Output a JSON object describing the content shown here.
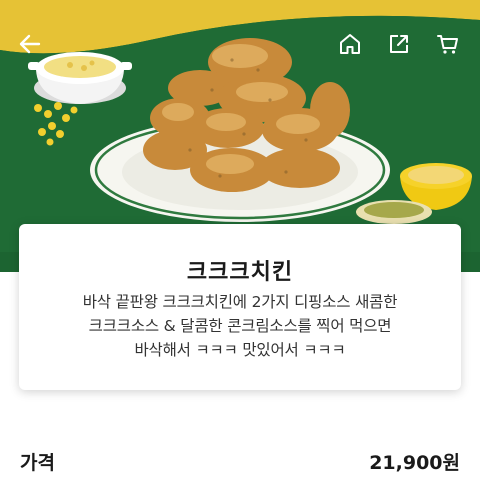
{
  "header": {
    "back_icon": "back-arrow-icon",
    "home_icon": "home-icon",
    "share_icon": "share-icon",
    "cart_icon": "cart-icon",
    "icon_color": "#ffffff"
  },
  "hero": {
    "background_color": "#1f6a34",
    "accent_color": "#e8c53a",
    "image": "fried chicken plate with dipping sauces"
  },
  "product": {
    "name": "크크크치킨",
    "description_lines": [
      "바삭 끝판왕 크크크치킨에 2가지 디핑소스 새콤한",
      "크크크소스 & 달콤한 콘크림소스를 찍어 먹으면",
      "바삭해서 ㅋㅋㅋ 맛있어서 ㅋㅋㅋ"
    ]
  },
  "price": {
    "label": "가격",
    "value": "21,900원"
  }
}
